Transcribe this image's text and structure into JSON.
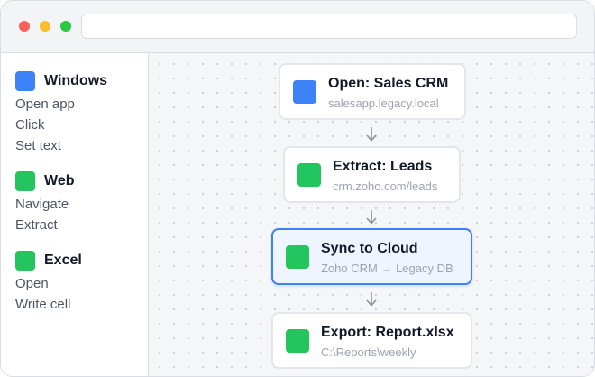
{
  "colors": {
    "windows": "#3b82f6",
    "web": "#22c55e",
    "excel": "#22c55e",
    "selected_border": "#3b82f6"
  },
  "window": {
    "controls": [
      "close",
      "minimize",
      "maximize"
    ],
    "address": ""
  },
  "sidebar": {
    "groups": [
      {
        "title": "Windows",
        "icon": "windows-category-icon",
        "items": [
          "Open app",
          "Click",
          "Set text"
        ]
      },
      {
        "title": "Web",
        "icon": "web-category-icon",
        "items": [
          "Navigate",
          "Extract"
        ]
      },
      {
        "title": "Excel",
        "icon": "excel-category-icon",
        "items": [
          "Open",
          "Write cell"
        ]
      }
    ]
  },
  "flow": {
    "nodes": [
      {
        "title": "Open: Sales CRM",
        "subtitle": "salesapp.legacy.local",
        "category": "windows"
      },
      {
        "title": "Extract: Leads",
        "subtitle": "crm.zoho.com/leads",
        "category": "web"
      },
      {
        "title": "Sync to Cloud",
        "subtitle": "Zoho CRM → Legacy DB",
        "category": "web",
        "selected": true
      },
      {
        "title": "Export: Report.xlsx",
        "subtitle": "C:\\Reports\\weekly",
        "category": "excel"
      }
    ]
  }
}
